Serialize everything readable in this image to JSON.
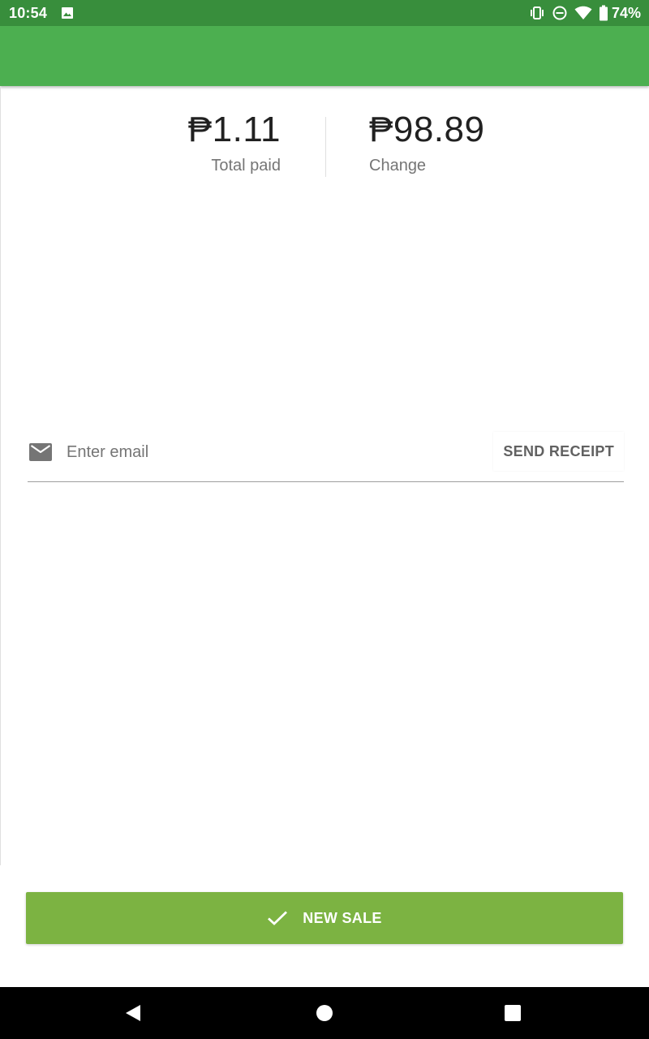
{
  "status_bar": {
    "time": "10:54",
    "battery_percent": "74%",
    "icons": [
      "image-icon",
      "vibrate-icon",
      "do-not-disturb-icon",
      "wifi-icon",
      "battery-icon"
    ]
  },
  "summary": {
    "total_paid": {
      "value": "₱1.11",
      "label": "Total paid"
    },
    "change": {
      "value": "₱98.89",
      "label": "Change"
    }
  },
  "receipt": {
    "email_icon": "mail-icon",
    "email_placeholder": "Enter email",
    "email_value": "",
    "send_label": "SEND RECEIPT"
  },
  "actions": {
    "new_sale_label": "NEW SALE",
    "new_sale_icon": "check-icon"
  },
  "navigation": {
    "icons": [
      "back-icon",
      "home-icon",
      "recents-icon"
    ]
  },
  "colors": {
    "status_bar": "#388e3c",
    "app_bar": "#4caf50",
    "primary_button": "#7cb342"
  }
}
